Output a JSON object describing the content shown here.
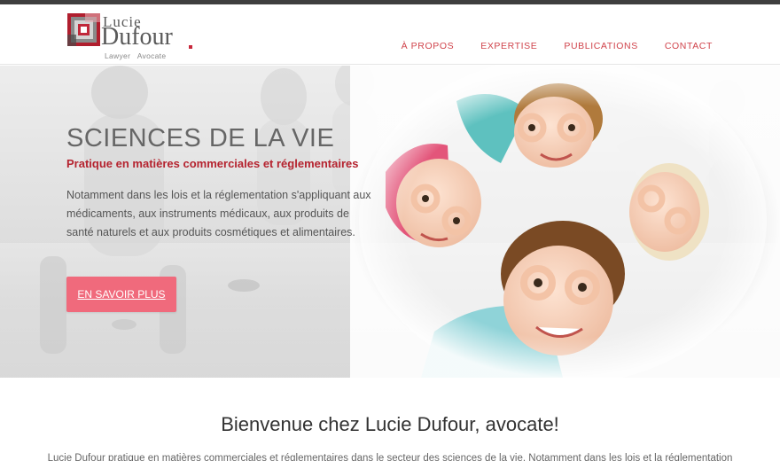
{
  "brand": {
    "name_first": "Lucie",
    "name_last": "Dufour",
    "tagline": "Lawyer   Avocate"
  },
  "nav": {
    "items": [
      {
        "label": "À PROPOS"
      },
      {
        "label": "EXPERTISE"
      },
      {
        "label": "PUBLICATIONS"
      },
      {
        "label": "CONTACT"
      }
    ]
  },
  "hero": {
    "title": "SCIENCES DE LA VIE",
    "subtitle": "Pratique en matières commerciales et réglementaires",
    "description": "Notamment dans les lois et la réglementation s'appliquant aux médicaments, aux instruments médicaux, aux produits de santé naturels et aux produits cosmétiques et alimentaires.",
    "cta_label": "EN SAVOIR PLUS"
  },
  "welcome": {
    "title": "Bienvenue chez Lucie Dufour, avocate!",
    "text": "Lucie Dufour pratique en matières commerciales et réglementaires dans le secteur des sciences de la vie. Notamment dans les lois et la réglementation"
  },
  "colors": {
    "accent": "#d0434b",
    "button": "#f06a7c",
    "subtitle": "#b5232f",
    "topbar": "#3f3f3f"
  }
}
